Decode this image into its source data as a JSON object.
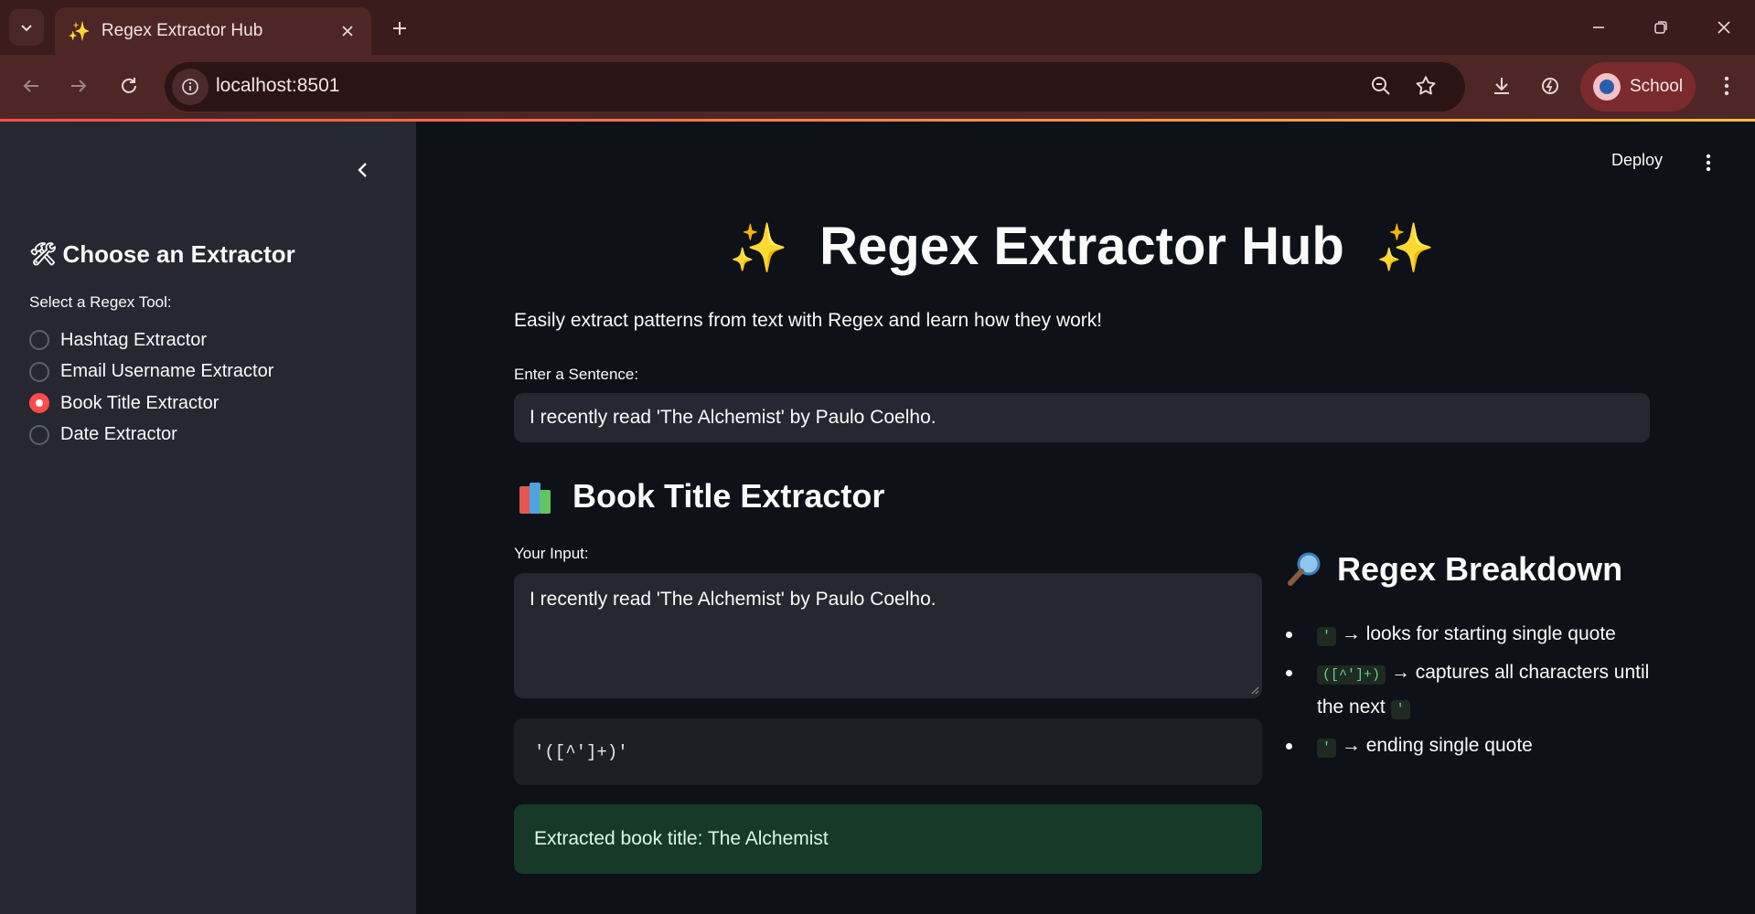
{
  "browser": {
    "tab_title": "Regex Extractor Hub",
    "tab_icon": "sparkles-icon",
    "url": "localhost:8501",
    "profile_name": "School",
    "accent_color": "#ff4b4b"
  },
  "sidebar": {
    "header": "Choose an Extractor",
    "radio_label": "Select a Regex Tool:",
    "options": [
      {
        "label": "Hashtag Extractor",
        "selected": false
      },
      {
        "label": "Email Username Extractor",
        "selected": false
      },
      {
        "label": "Book Title Extractor",
        "selected": true
      },
      {
        "label": "Date Extractor",
        "selected": false
      }
    ]
  },
  "header": {
    "deploy_label": "Deploy"
  },
  "main": {
    "title": "Regex Extractor Hub",
    "title_emoji": "✨",
    "subtitle": "Easily extract patterns from text with Regex and learn how they work!",
    "sentence_label": "Enter a Sentence:",
    "sentence_value": "I recently read 'The Alchemist' by Paulo Coelho.",
    "section_title": "Book Title Extractor",
    "your_input_label": "Your Input:",
    "your_input_value": "I recently read 'The Alchemist' by Paulo Coelho.",
    "regex_pattern": "'([^']+)'",
    "result": "Extracted book title: The Alchemist"
  },
  "breakdown": {
    "title": "Regex Breakdown",
    "items": [
      {
        "code": "'",
        "text": "→ looks for starting single quote",
        "trail_code": ""
      },
      {
        "code": "([^']+)",
        "text": "→ captures all characters until the next",
        "trail_code": "'"
      },
      {
        "code": "'",
        "text": "→ ending single quote",
        "trail_code": ""
      }
    ]
  }
}
